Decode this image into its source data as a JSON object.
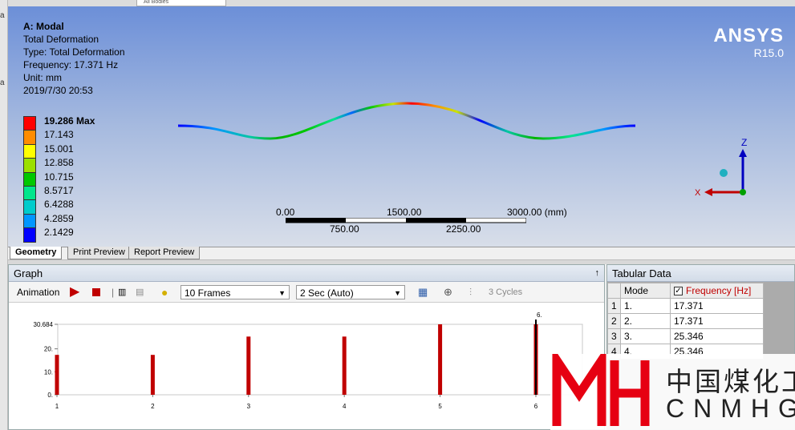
{
  "top_fragment": {
    "tab_label": "All Bodies"
  },
  "viewport": {
    "info": {
      "title": "A: Modal",
      "result": "Total Deformation",
      "type": "Type: Total Deformation",
      "frequency": "Frequency: 17.371 Hz",
      "unit": "Unit: mm",
      "timestamp": "2019/7/30 20:53"
    },
    "logo": {
      "name": "ANSYS",
      "version": "R15.0"
    },
    "legend": {
      "labels": [
        "19.286 Max",
        "17.143",
        "15.001",
        "12.858",
        "10.715",
        "8.5717",
        "6.4288",
        "4.2859",
        "2.1429"
      ],
      "colors": [
        "#ff0000",
        "#ff8c00",
        "#ffff00",
        "#9be000",
        "#00c800",
        "#00e68c",
        "#00cccc",
        "#0096ff",
        "#0000ff"
      ]
    },
    "scale_bar": {
      "top_labels": [
        "0.00",
        "1500.00",
        "3000.00 (mm)"
      ],
      "bottom_labels": [
        "750.00",
        "2250.00"
      ]
    },
    "triad": {
      "z_label": "Z",
      "x_label": "X"
    }
  },
  "view_tabs": [
    "Geometry",
    "Print Preview",
    "Report Preview"
  ],
  "graph": {
    "title": "Graph",
    "pin": "↑",
    "toolbar": {
      "animation_label": "Animation",
      "frames": "10 Frames",
      "duration": "2 Sec (Auto)",
      "cycles": "3 Cycles"
    },
    "chart_data": {
      "type": "bar",
      "categories": [
        "1",
        "2",
        "3",
        "4",
        "5",
        "6"
      ],
      "values": [
        17.371,
        17.371,
        25.346,
        25.346,
        30.684,
        30.684
      ],
      "yticks": [
        "0.",
        "10.",
        "20.",
        "30.684"
      ],
      "ylim": [
        0,
        30.684
      ],
      "annotation": "6.",
      "bar_color": "#c00000"
    }
  },
  "tabular": {
    "title": "Tabular Data",
    "col_mode": "Mode",
    "col_freq": "Frequency [Hz]",
    "rows": [
      {
        "n": "1",
        "mode": "1.",
        "freq": "17.371"
      },
      {
        "n": "2",
        "mode": "2.",
        "freq": "17.371"
      },
      {
        "n": "3",
        "mode": "3.",
        "freq": "25.346"
      },
      {
        "n": "4",
        "mode": "4.",
        "freq": "25.346"
      }
    ]
  },
  "watermark": {
    "chinese": "中国煤化工",
    "latin": "CNMHG"
  }
}
